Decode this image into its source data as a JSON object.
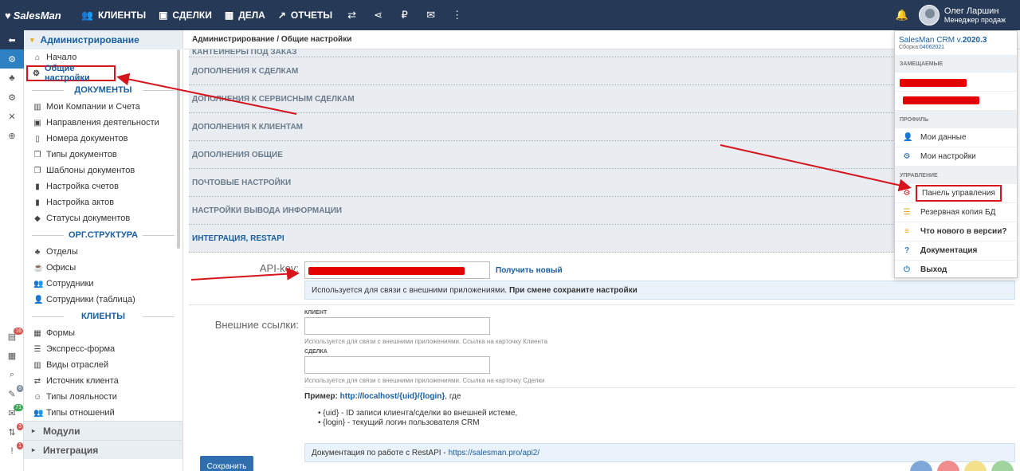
{
  "topbar": {
    "logo": "SalesMan",
    "nav": [
      {
        "label": "КЛИЕНТЫ",
        "icon": "users-icon"
      },
      {
        "label": "СДЕЛКИ",
        "icon": "briefcase-icon"
      },
      {
        "label": "ДЕЛА",
        "icon": "calendar-icon"
      },
      {
        "label": "ОТЧЕТЫ",
        "icon": "chart-icon"
      }
    ],
    "user_name": "Олег Ларшин",
    "user_role": "Менеджер продаж"
  },
  "breadcrumb": "Администрирование / Общие настройки",
  "sidebar": {
    "header": "Администрирование",
    "start": "Начало",
    "general": "Общие настройки",
    "sections": {
      "documents": "ДОКУМЕНТЫ",
      "org": "ОРГ.СТРУКТУРА",
      "clients": "КЛИЕНТЫ"
    },
    "documents": [
      "Мои Компании и Счета",
      "Направления деятельности",
      "Номера документов",
      "Типы документов",
      "Шаблоны документов",
      "Настройка счетов",
      "Настройка актов",
      "Статусы документов"
    ],
    "org": [
      "Отделы",
      "Офисы",
      "Сотрудники",
      "Сотрудники (таблица)"
    ],
    "clients": [
      "Формы",
      "Экспресс-форма",
      "Виды отраслей",
      "Источник клиента",
      "Типы лояльности",
      "Типы отношений"
    ],
    "groups": [
      "Модули",
      "Интеграция"
    ]
  },
  "rail_badges": [
    "16",
    "8",
    "71",
    "3",
    "1"
  ],
  "accordion": {
    "partial": "КАНТЕЙНЕРЫ ПОД ЗАКАЗ",
    "items": [
      "ДОПОЛНЕНИЯ К СДЕЛКАМ",
      "ДОПОЛНЕНИЯ К СЕРВИСНЫМ СДЕЛКАМ",
      "ДОПОЛНЕНИЯ К КЛИЕНТАМ",
      "ДОПОЛНЕНИЯ ОБЩИЕ",
      "ПОЧТОВЫЕ НАСТРОЙКИ",
      "НАСТРОЙКИ ВЫВОДА ИНФОРМАЦИИ"
    ],
    "open": "ИНТЕГРАЦИЯ, RESTAPI"
  },
  "form": {
    "api_label": "API-key:",
    "get_new": "Получить новый",
    "api_info_a": "Используется для связи с внешними приложениями.",
    "api_info_b": "При смене сохраните настройки",
    "ext_label": "Внешние ссылки:",
    "client_cap": "КЛИЕНТ",
    "client_hint": "Используется для связи с внешними приложениями. Ссылка на карточку Клиента",
    "deal_cap": "СДЕЛКА",
    "deal_hint": "Используется для связи с внешними приложениями. Ссылка на карточку Сделки",
    "example_label": "Пример:",
    "example_link": "http://localhost/{uid}/{login}",
    "example_tail": ", где",
    "bullet1": "{uid} - ID записи клиента/сделки во внешней истеме,",
    "bullet2": "{login} - текущий логин пользователя CRM",
    "doc_text": "Документация по работе с RestAPI - ",
    "doc_link": "https://salesman.pro/api2/",
    "save": "Сохранить"
  },
  "dropdown": {
    "version_prefix": "SalesMan CRM v.",
    "version": "2020.3",
    "build_label": "Сборка:",
    "build": "04062021",
    "sec_replace": "ЗАМЕЩАЕМЫЕ",
    "sec_profile": "ПРОФИЛЬ",
    "my_data": "Мои данные",
    "my_settings": "Мои настройки",
    "sec_manage": "УПРАВЛЕНИЕ",
    "control_panel": "Панель управления",
    "backup": "Резервная копия БД",
    "whats_new": "Что нового в версии?",
    "docs": "Документация",
    "logout": "Выход"
  },
  "colors": {
    "accent": "#1a5fa0",
    "topbar": "#263a57",
    "highlight": "#d6141d"
  }
}
